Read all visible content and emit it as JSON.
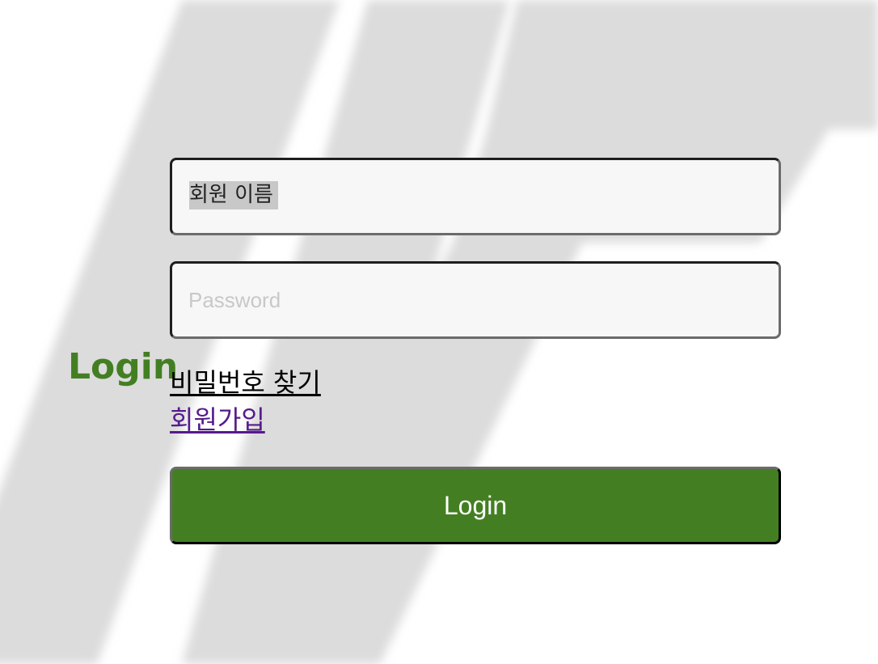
{
  "heading": "Login",
  "username": {
    "value": "회원 이름"
  },
  "password": {
    "placeholder": "Password",
    "value": ""
  },
  "links": {
    "find_password": "비밀번호 찾기",
    "sign_up": "회원가입"
  },
  "login_button": {
    "label": "Login"
  },
  "colors": {
    "accent": "#437f22",
    "visited_link": "#551a8b",
    "field_bg": "#f7f7f7",
    "background_stripes": "#dcdcdc"
  }
}
